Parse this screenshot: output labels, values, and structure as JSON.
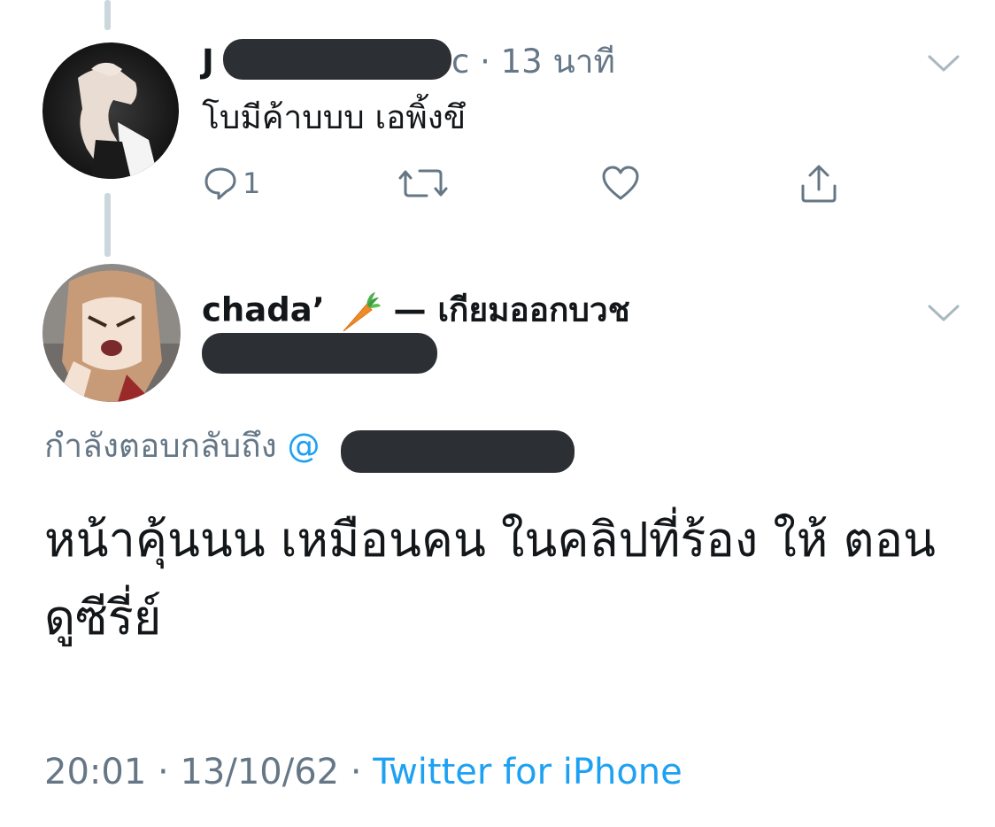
{
  "reply_tweet": {
    "name_first_char": "J",
    "name_last_char": "c",
    "time_sep": "·",
    "time": "13 นาที",
    "text": "โบมีค้าบบบ เอพิ้งขึ",
    "reply_count": "1",
    "avatar_icon": "hands-photo-avatar"
  },
  "main_tweet": {
    "display_name": "chada’",
    "display_name_emoji": "carrot-emoji",
    "display_name_suffix": "— เกียมออกบวช",
    "reply_to_label": "กำลังตอบกลับถึง",
    "reply_to_at": "@",
    "text": "หน้าคุ้นนน เหมือนคน ในคลิปที่ร้อง ให้ ตอนดูซีรี่ย์",
    "time": "20:01",
    "sep": "·",
    "date": "13/10/62",
    "sep2": "·",
    "source": "Twitter for iPhone",
    "avatar_icon": "anime-girl-avatar"
  },
  "colors": {
    "text": "#14171a",
    "muted": "#657786",
    "link": "#1da1f2",
    "redaction": "#2c2f33",
    "thread_line": "#ccd6dd"
  }
}
